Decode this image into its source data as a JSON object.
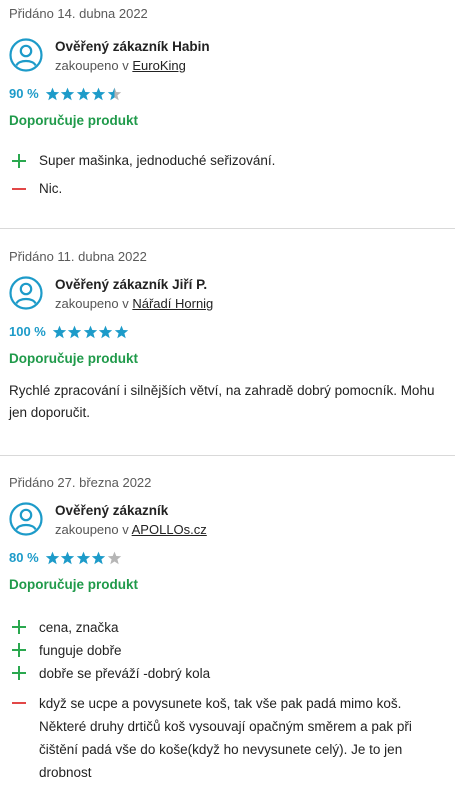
{
  "colors": {
    "accent": "#1d9bc9",
    "recommend": "#1f9a4a",
    "plus": "#2aa84f",
    "minus": "#e24747",
    "star_empty": "#b6b6b6"
  },
  "reviews": [
    {
      "date": "Přidáno 14. dubna 2022",
      "author": "Ověřený zákazník Habin",
      "shop_prefix": "zakoupeno v",
      "shop": "EuroKing",
      "percent": "90 %",
      "stars": 4.5,
      "recommend": "Doporučuje produkt",
      "pros": [
        "Super mašinka, jednoduché seřizování."
      ],
      "cons": [
        "Nic."
      ]
    },
    {
      "date": "Přidáno 11. dubna 2022",
      "author": "Ověřený zákazník Jiří P.",
      "shop_prefix": "zakoupeno v",
      "shop": "Nářadí Hornig",
      "percent": "100 %",
      "stars": 5,
      "recommend": "Doporučuje produkt",
      "text": "Rychlé zpracování i silnějších větví, na zahradě dobrý pomocník. Mohu jen doporučit."
    },
    {
      "date": "Přidáno 27. března 2022",
      "author": "Ověřený zákazník",
      "shop_prefix": "zakoupeno v",
      "shop": "APOLLOs.cz",
      "percent": "80 %",
      "stars": 4,
      "recommend": "Doporučuje produkt",
      "pros": [
        "cena, značka",
        "funguje dobře",
        "dobře se převáží -dobrý kola"
      ],
      "cons": [
        "když se ucpe a povysunete koš, tak vše pak padá mimo koš. Některé druhy drtičů koš vysouvají opačným směrem a pak při čištění padá vše do koše(když ho nevysunete celý). Je to jen drobnost"
      ]
    }
  ]
}
